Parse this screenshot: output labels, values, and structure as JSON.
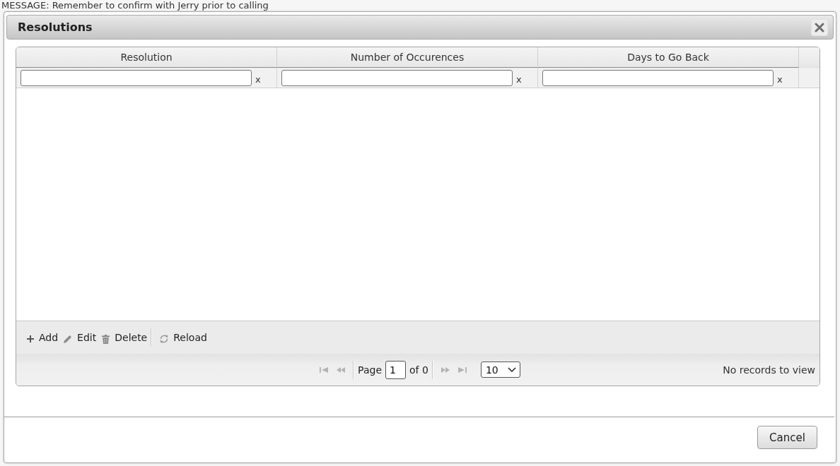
{
  "background": {
    "message": "MESSAGE: Remember to confirm with Jerry prior to calling"
  },
  "dialog": {
    "title": "Resolutions",
    "grid": {
      "columns": [
        {
          "label": "Resolution",
          "filter_clear": "x"
        },
        {
          "label": "Number of Occurences",
          "filter_clear": "x"
        },
        {
          "label": "Days to Go Back",
          "filter_clear": "x"
        }
      ],
      "toolbar": [
        [
          {
            "kind": "add",
            "label": "Add"
          },
          {
            "kind": "edit",
            "label": "Edit"
          },
          {
            "kind": "delete",
            "label": "Delete"
          }
        ],
        [
          {
            "kind": "reload",
            "label": "Reload"
          }
        ]
      ],
      "pager": {
        "nav_back": [
          {
            "kind": "first",
            "disabled": true
          },
          {
            "kind": "prev",
            "disabled": true
          }
        ],
        "page_label": "Page",
        "page": "1",
        "page_count": "of 0",
        "nav_forward": [
          {
            "kind": "next",
            "disabled": true
          },
          {
            "kind": "last",
            "disabled": true
          }
        ],
        "page_size": "10",
        "status": "No records to view"
      }
    },
    "buttons": [
      {
        "label": "Cancel"
      }
    ]
  }
}
